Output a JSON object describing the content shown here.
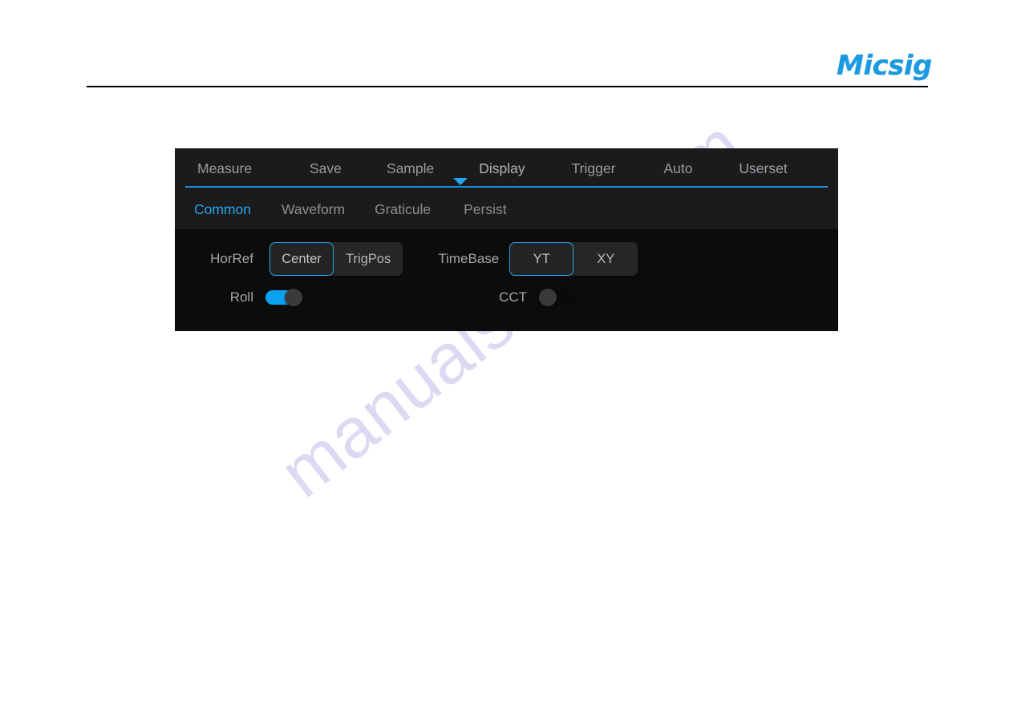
{
  "page": {
    "background": "#ffffff",
    "watermark": "manualshive.com",
    "brand": "Micsig",
    "brand_color": "#1b9ae0"
  },
  "scope": {
    "accent_color": "#25a6ee",
    "panel_bg": "#0c0c0c",
    "menu": {
      "items": [
        {
          "label": "Measure",
          "active": false
        },
        {
          "label": "Save",
          "active": false
        },
        {
          "label": "Sample",
          "active": false
        },
        {
          "label": "Display",
          "active": true
        },
        {
          "label": "Trigger",
          "active": false
        },
        {
          "label": "Auto",
          "active": false
        },
        {
          "label": "Userset",
          "active": false
        }
      ]
    },
    "subtabs": {
      "items": [
        {
          "label": "Common",
          "active": true
        },
        {
          "label": "Waveform",
          "active": false
        },
        {
          "label": "Graticule",
          "active": false
        },
        {
          "label": "Persist",
          "active": false
        }
      ]
    },
    "controls": {
      "horref": {
        "label": "HorRef",
        "options": [
          "Center",
          "TrigPos"
        ],
        "selected": "Center"
      },
      "timebase": {
        "label": "TimeBase",
        "options": [
          "YT",
          "XY"
        ],
        "selected": "YT"
      },
      "roll": {
        "label": "Roll",
        "state": "on"
      },
      "cct": {
        "label": "CCT",
        "state": "off"
      }
    }
  }
}
